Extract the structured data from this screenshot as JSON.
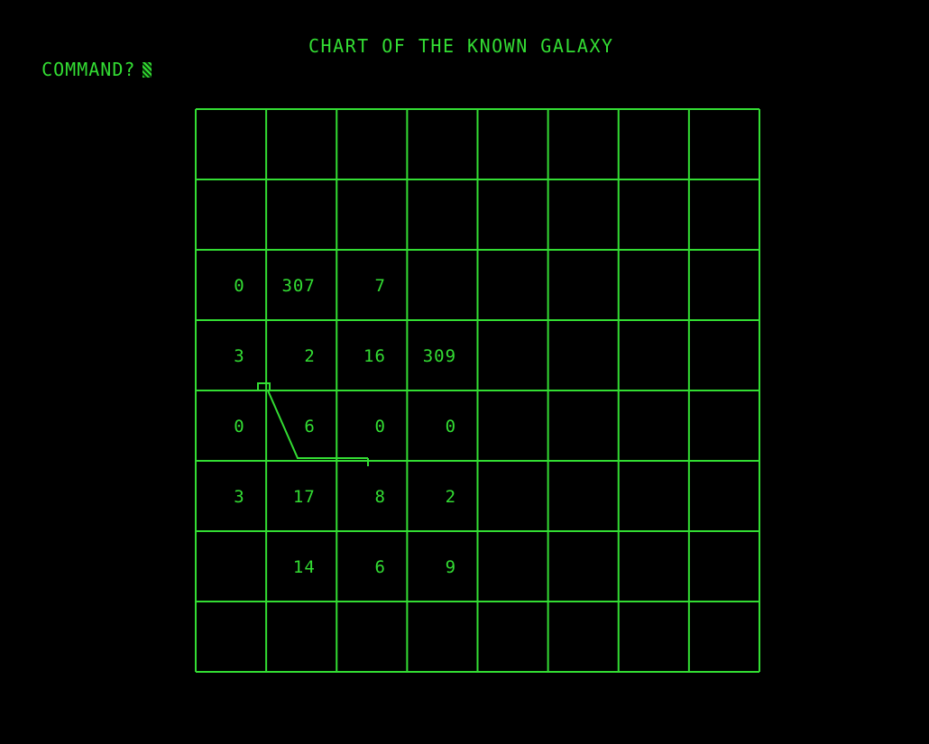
{
  "prompt": {
    "label": "COMMAND?"
  },
  "title": "CHART OF THE KNOWN GALAXY",
  "colors": {
    "background": "#000000",
    "phosphor": "#33dd33"
  },
  "galaxy": {
    "rows": 8,
    "cols": 8,
    "cells": [
      [
        "",
        "",
        "",
        "",
        "",
        "",
        "",
        ""
      ],
      [
        "",
        "",
        "",
        "",
        "",
        "",
        "",
        ""
      ],
      [
        "0",
        "307",
        "7",
        "",
        "",
        "",
        "",
        ""
      ],
      [
        "3",
        "2",
        "16",
        "309",
        "",
        "",
        "",
        ""
      ],
      [
        "0",
        "6",
        "0",
        "0",
        "",
        "",
        "",
        ""
      ],
      [
        "3",
        "17",
        "8",
        "2",
        "",
        "",
        "",
        ""
      ],
      [
        "",
        "14",
        "6",
        "9",
        "",
        "",
        "",
        ""
      ],
      [
        "",
        "",
        "",
        "",
        "",
        "",
        "",
        ""
      ]
    ]
  }
}
